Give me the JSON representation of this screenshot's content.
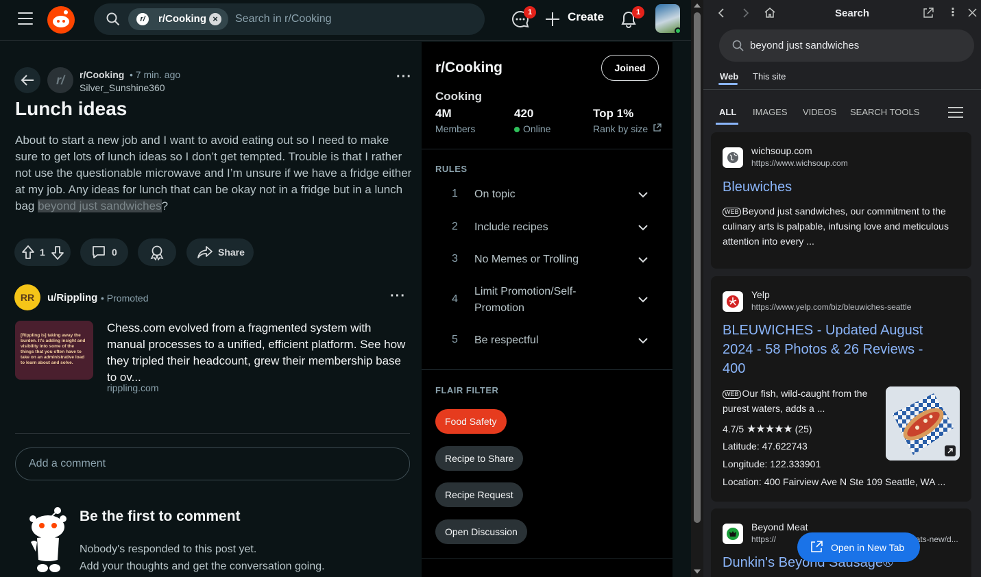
{
  "header": {
    "search_chip": "r/Cooking",
    "search_placeholder": "Search in r/Cooking",
    "chat_badge": "1",
    "create_label": "Create",
    "notif_badge": "1"
  },
  "post": {
    "subreddit": "r/Cooking",
    "time": "• 7 min. ago",
    "author": "Silver_Sunshine360",
    "title": "Lunch ideas",
    "body_main": "About to start a new job and I want to avoid eating out so I need to make sure to get lots of lunch ideas so I don’t get tempted. Trouble is that I rather not use the questionable microwave and I’m unsure if we have a fridge either at my job. Any ideas for lunch that can be okay not in a fridge but in a lunch bag ",
    "body_highlight": "beyond just sandwiches",
    "body_end": "?",
    "votes": "1",
    "comments": "0",
    "share_label": "Share"
  },
  "promo": {
    "user": "u/Rippling",
    "tag": "Promoted",
    "image_text": "[Rippling is] taking away the burden. It’s adding insight and visibility into some of the things that you often have to take on an administrative load to learn about and solve.",
    "text": "Chess.com evolved from a fragmented system with manual processes to a unified, efficient platform. See how they tripled their headcount, grew their membership base to ov...",
    "link": "rippling.com"
  },
  "comment": {
    "placeholder": "Add a comment",
    "empty_title": "Be the first to comment",
    "empty_line1": "Nobody's responded to this post yet.",
    "empty_line2": "Add your thoughts and get the conversation going."
  },
  "sidebar": {
    "title": "r/Cooking",
    "joined_label": "Joined",
    "name": "Cooking",
    "stats": [
      {
        "value": "4M",
        "label": "Members"
      },
      {
        "value": "420",
        "label": "Online"
      },
      {
        "value": "Top 1%",
        "label": "Rank by size"
      }
    ],
    "rules_heading": "RULES",
    "rules": [
      {
        "num": "1",
        "text": "On topic"
      },
      {
        "num": "2",
        "text": "Include recipes"
      },
      {
        "num": "3",
        "text": "No Memes or Trolling"
      },
      {
        "num": "4",
        "text": "Limit Promotion/Self-Promotion"
      },
      {
        "num": "5",
        "text": "Be respectful"
      }
    ],
    "flair_heading": "FLAIR FILTER",
    "flairs": [
      "Food Safety",
      "Recipe to Share",
      "Recipe Request",
      "Open Discussion"
    ]
  },
  "search_panel": {
    "title": "Search",
    "query": "beyond just sandwiches",
    "scope_tabs": [
      "Web",
      "This site"
    ],
    "vertical_tabs": [
      "ALL",
      "IMAGES",
      "VIDEOS",
      "SEARCH TOOLS"
    ],
    "results": [
      {
        "site": "wichsoup.com",
        "url": "https://www.wichsoup.com",
        "title": "Bleuwiches",
        "web_tag": "WEB",
        "snippet": "Beyond just sandwiches, our commitment to the culinary arts is palpable, infusing love and meticulous attention into every ..."
      },
      {
        "site": "Yelp",
        "url": "https://www.yelp.com/biz/bleuwiches-seattle",
        "title": "BLEUWICHES - Updated August 2024 - 58 Photos & 26 Reviews - 400",
        "web_tag": "WEB",
        "snippet": "Our fish, wild-caught from the purest waters, adds a ...",
        "rating": "4.7/5",
        "stars": "★★★★★",
        "review_count": "(25)",
        "latitude": "Latitude: 47.622743",
        "longitude": "Longitude: 122.333901",
        "location": "Location: 400 Fairview Ave N Ste 109 Seattle, WA ..."
      },
      {
        "site": "Beyond Meat",
        "url": "https://",
        "url_tail": "/whats-new/d...",
        "title": "Dunkin's Beyond Sausage®"
      }
    ],
    "open_new_tab": "Open in New Tab"
  },
  "colors": {
    "reddit_orange": "#ff4500",
    "link_blue": "#8ab4f8",
    "flair_red": "#e63b1e",
    "online_green": "#2fbf5a"
  }
}
